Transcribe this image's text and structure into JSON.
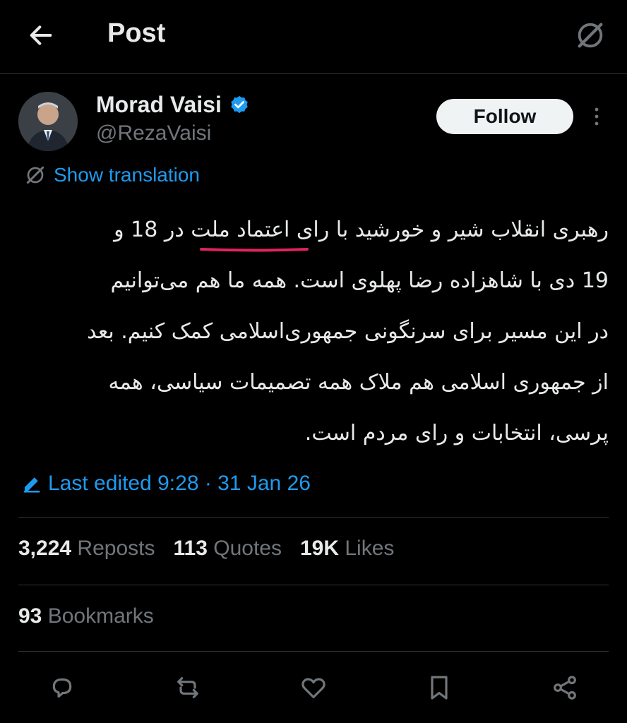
{
  "header": {
    "title": "Post",
    "back_icon": "arrow-left-icon",
    "grok_icon": "grok-icon"
  },
  "author": {
    "name": "Morad Vaisi",
    "handle": "@RezaVaisi",
    "verified_badge_color": "#1d9bf0",
    "follow_label": "Follow",
    "more_icon": "more-vertical-icon"
  },
  "translation": {
    "label": "Show translation"
  },
  "tweet": {
    "lines": [
      "رهبری انقلاب شیر و خورشید با رای اعتماد ملت در 18 و",
      "19 دی با شاهزاده رضا پهلوی است. همه ما هم می‌توانیم",
      "در این مسیر برای سرنگونی جمهوری‌اسلامی کمک کنیم. بعد",
      "از جمهوری اسلامی هم ملاک همه تصمیمات سیاسی، همه",
      "پرسی، انتخابات و رای مردم است."
    ]
  },
  "edited": {
    "label": "Last edited 9:28 · 31 Jan 26"
  },
  "stats": {
    "reposts_count": "3,224",
    "reposts_label": "Reposts",
    "quotes_count": "113",
    "quotes_label": "Quotes",
    "likes_count": "19K",
    "likes_label": "Likes",
    "bookmarks_count": "93",
    "bookmarks_label": "Bookmarks"
  },
  "actions": [
    "reply-icon",
    "repost-icon",
    "like-icon",
    "bookmark-icon",
    "share-icon"
  ],
  "colors": {
    "accent": "#1d9bf0",
    "underline": "#e0245e",
    "muted": "#71767b",
    "background": "#000000"
  }
}
